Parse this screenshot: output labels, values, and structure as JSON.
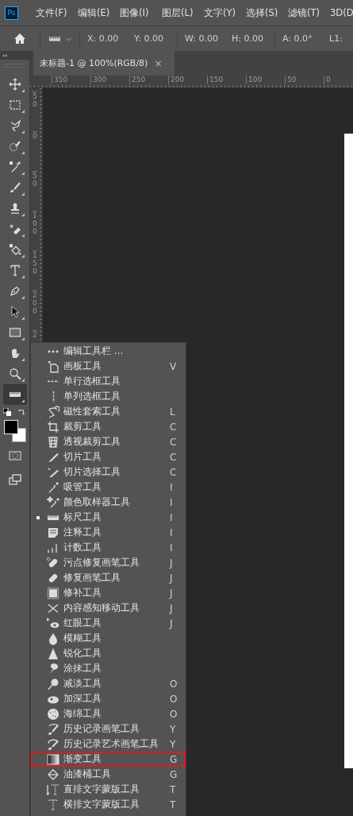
{
  "app_logo": "Ps",
  "menu_bar": [
    "文件(F)",
    "编辑(E)",
    "图像(I)",
    "图层(L)",
    "文字(Y)",
    "选择(S)",
    "滤镜(T)",
    "3D(D"
  ],
  "options_bar": {
    "fields": [
      "X: 0.00",
      "Y: 0.00",
      "W: 0.00",
      "H: 0.00",
      "A: 0.0°",
      "L1:"
    ]
  },
  "toolbar": {
    "tools": [
      {
        "selected": false
      },
      {
        "selected": false
      },
      {
        "selected": false
      },
      {
        "selected": false
      },
      {
        "selected": false
      },
      {
        "selected": false
      },
      {
        "selected": false
      },
      {
        "selected": false
      },
      {
        "selected": false
      },
      {
        "selected": false
      },
      {
        "selected": false
      },
      {
        "selected": false
      },
      {
        "selected": false
      },
      {
        "selected": false
      },
      {
        "selected": false
      },
      {
        "selected": true
      }
    ]
  },
  "document_tab": {
    "title": "未标题-1 @ 100%(RGB/8)",
    "close": "×"
  },
  "ruler_horizontal": [
    "350",
    "300",
    "250",
    "200",
    "150",
    "100",
    "50",
    "0"
  ],
  "ruler_vertical": [
    "50",
    "0",
    "50",
    "100",
    "150",
    "200",
    "2"
  ],
  "tool_flyout": {
    "items": [
      {
        "label": "编辑工具栏 ...",
        "selected": false,
        "highlighted": false
      },
      {
        "label": "画板工具",
        "shortcut": "V",
        "selected": false,
        "highlighted": false
      },
      {
        "label": "单行选框工具",
        "selected": false,
        "highlighted": false
      },
      {
        "label": "单列选框工具",
        "selected": false,
        "highlighted": false
      },
      {
        "label": "磁性套索工具",
        "shortcut": "L",
        "selected": false,
        "highlighted": false
      },
      {
        "label": "裁剪工具",
        "shortcut": "C",
        "selected": false,
        "highlighted": false
      },
      {
        "label": "透视裁剪工具",
        "shortcut": "C",
        "selected": false,
        "highlighted": false
      },
      {
        "label": "切片工具",
        "shortcut": "C",
        "selected": false,
        "highlighted": false
      },
      {
        "label": "切片选择工具",
        "shortcut": "C",
        "selected": false,
        "highlighted": false
      },
      {
        "label": "吸管工具",
        "shortcut": "I",
        "selected": false,
        "highlighted": false
      },
      {
        "label": "颜色取样器工具",
        "shortcut": "I",
        "selected": false,
        "highlighted": false
      },
      {
        "label": "标尺工具",
        "shortcut": "I",
        "selected": true,
        "highlighted": false
      },
      {
        "label": "注释工具",
        "shortcut": "I",
        "selected": false,
        "highlighted": false
      },
      {
        "label": "计数工具",
        "shortcut": "I",
        "selected": false,
        "highlighted": false
      },
      {
        "label": "污点修复画笔工具",
        "shortcut": "J",
        "selected": false,
        "highlighted": false
      },
      {
        "label": "修复画笔工具",
        "shortcut": "J",
        "selected": false,
        "highlighted": false
      },
      {
        "label": "修补工具",
        "shortcut": "J",
        "selected": false,
        "highlighted": false
      },
      {
        "label": "内容感知移动工具",
        "shortcut": "J",
        "selected": false,
        "highlighted": false
      },
      {
        "label": "红眼工具",
        "shortcut": "J",
        "selected": false,
        "highlighted": false
      },
      {
        "label": "模糊工具",
        "selected": false,
        "highlighted": false
      },
      {
        "label": "锐化工具",
        "selected": false,
        "highlighted": false
      },
      {
        "label": "涂抹工具",
        "selected": false,
        "highlighted": false
      },
      {
        "label": "减淡工具",
        "shortcut": "O",
        "selected": false,
        "highlighted": false
      },
      {
        "label": "加深工具",
        "shortcut": "O",
        "selected": false,
        "highlighted": false
      },
      {
        "label": "海绵工具",
        "shortcut": "O",
        "selected": false,
        "highlighted": false
      },
      {
        "label": "历史记录画笔工具",
        "shortcut": "Y",
        "selected": false,
        "highlighted": false
      },
      {
        "label": "历史记录艺术画笔工具",
        "shortcut": "Y",
        "selected": false,
        "highlighted": false
      },
      {
        "label": "渐变工具",
        "shortcut": "G",
        "selected": false,
        "highlighted": true
      },
      {
        "label": "油漆桶工具",
        "shortcut": "G",
        "selected": false,
        "highlighted": false
      },
      {
        "label": "直排文字蒙版工具",
        "shortcut": "T",
        "selected": false,
        "highlighted": false
      },
      {
        "label": "横排文字蒙版工具",
        "shortcut": "T",
        "selected": false,
        "highlighted": false
      }
    ]
  }
}
